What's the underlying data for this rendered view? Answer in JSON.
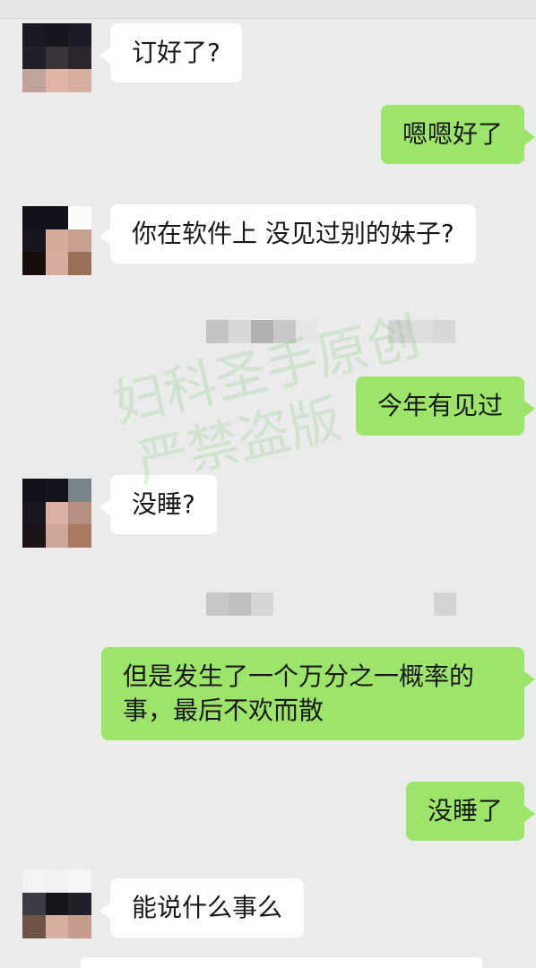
{
  "messages": [
    {
      "side": "in",
      "text": "订好了?"
    },
    {
      "side": "out",
      "text": "嗯嗯好了"
    },
    {
      "side": "in",
      "text": "你在软件上 没见过别的妹子?"
    },
    {
      "side": "out",
      "text": "今年有见过"
    },
    {
      "side": "in",
      "text": "没睡?"
    },
    {
      "side": "out",
      "text": "但是发生了一个万分之一概率的事，最后不欢而散"
    },
    {
      "side": "out",
      "text": "没睡了"
    },
    {
      "side": "in",
      "text": "能说什么事么"
    }
  ],
  "watermark": {
    "line1": "妇科圣手原创",
    "line2": "严禁盗版"
  },
  "colors": {
    "background": "#ebebeb",
    "incoming_bubble": "#ffffff",
    "outgoing_bubble": "#9de46a",
    "text": "#191919"
  }
}
